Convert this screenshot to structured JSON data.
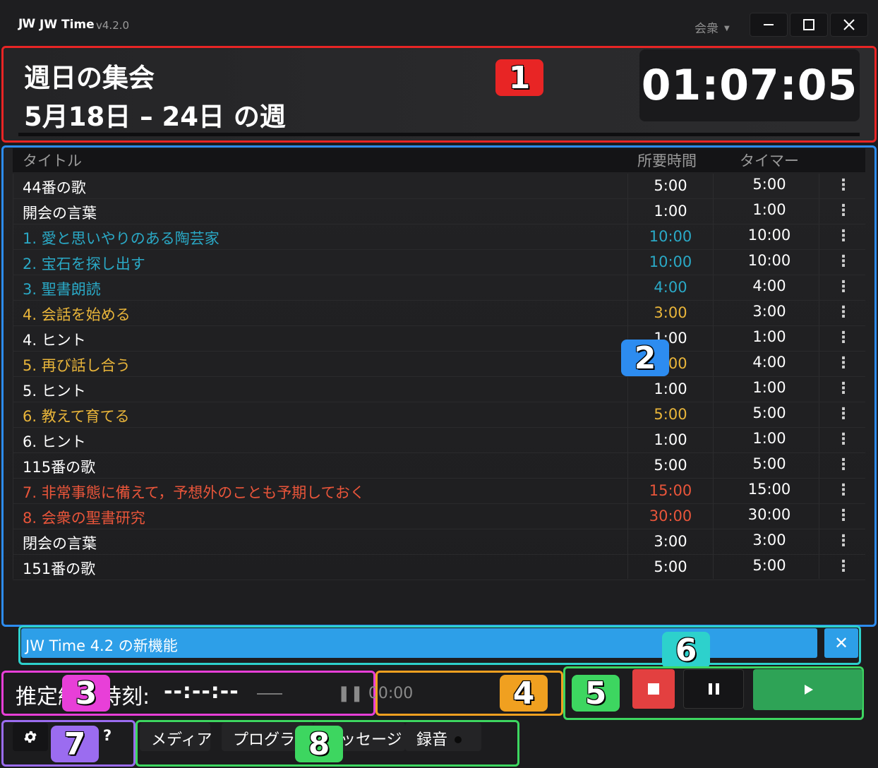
{
  "window": {
    "logo_text": "JW",
    "app_name": "JW Time",
    "version": "v4.2.0",
    "congregation_label": "会衆",
    "minimize_glyph": "—",
    "maximize_glyph": "☐",
    "close_glyph": "✕"
  },
  "header": {
    "title": "週日の集会",
    "week": "5月18日 – 24日 の週",
    "clock": "01:07:05"
  },
  "table": {
    "columns": {
      "title": "タイトル",
      "duration": "所要時間",
      "timer": "タイマー"
    },
    "rows": [
      {
        "title": "44番の歌",
        "duration": "5:00",
        "timer": "5:00",
        "color": "#ffffff"
      },
      {
        "title": "開会の言葉",
        "duration": "1:00",
        "timer": "1:00",
        "color": "#ffffff"
      },
      {
        "title": "1. 愛と思いやりのある陶芸家",
        "duration": "10:00",
        "timer": "10:00",
        "color": "#2aa9c6"
      },
      {
        "title": "2. 宝石を探し出す",
        "duration": "10:00",
        "timer": "10:00",
        "color": "#2aa9c6"
      },
      {
        "title": "3. 聖書朗読",
        "duration": "4:00",
        "timer": "4:00",
        "color": "#2aa9c6"
      },
      {
        "title": "4. 会話を始める",
        "duration": "3:00",
        "timer": "3:00",
        "color": "#e9b53a"
      },
      {
        "title": "4. ヒント",
        "duration": "1:00",
        "timer": "1:00",
        "color": "#ffffff"
      },
      {
        "title": "5. 再び話し合う",
        "duration": "4:00",
        "timer": "4:00",
        "color": "#e9b53a"
      },
      {
        "title": "5. ヒント",
        "duration": "1:00",
        "timer": "1:00",
        "color": "#ffffff"
      },
      {
        "title": "6. 教えて育てる",
        "duration": "5:00",
        "timer": "5:00",
        "color": "#e9b53a"
      },
      {
        "title": "6. ヒント",
        "duration": "1:00",
        "timer": "1:00",
        "color": "#ffffff"
      },
      {
        "title": "115番の歌",
        "duration": "5:00",
        "timer": "5:00",
        "color": "#ffffff"
      },
      {
        "title": "7. 非常事態に備えて，予想外のことも予期しておく",
        "duration": "15:00",
        "timer": "15:00",
        "color": "#e9553a"
      },
      {
        "title": "8. 会衆の聖書研究",
        "duration": "30:00",
        "timer": "30:00",
        "color": "#e9553a"
      },
      {
        "title": "閉会の言葉",
        "duration": "3:00",
        "timer": "3:00",
        "color": "#ffffff"
      },
      {
        "title": "151番の歌",
        "duration": "5:00",
        "timer": "5:00",
        "color": "#ffffff"
      }
    ],
    "kebab_glyph": "⋮"
  },
  "notice": {
    "text": "JW Time 4.2 の新機能",
    "close_glyph": "✕"
  },
  "estimate": {
    "label": "推定終了時刻:",
    "value": "--:--:--",
    "pause_timer": "❚❚ 00:00"
  },
  "controls": {
    "stop_label": "stop",
    "pause_label": "pause",
    "play_glyph": "▶"
  },
  "footer": {
    "settings_icon": "gear-icon",
    "help_label": "?",
    "tabs": {
      "media": "メディア",
      "program": "プログラム",
      "message": "メッセージ",
      "record": "録音"
    }
  },
  "callouts": [
    "1",
    "2",
    "3",
    "4",
    "5",
    "6",
    "7",
    "8"
  ],
  "colors": {
    "callout_1": "#e82525",
    "callout_2": "#2d8cf0",
    "callout_3": "#e83fd8",
    "callout_4": "#f0a020",
    "callout_5": "#3dd660",
    "callout_6": "#2dd1cc",
    "callout_7": "#9b6cf0",
    "callout_8": "#3dd660",
    "talk_blue": "#2aa9c6",
    "talk_yellow": "#e9b53a",
    "talk_red": "#e9553a",
    "play_green": "#2ea356",
    "stop_red": "#e34040"
  }
}
